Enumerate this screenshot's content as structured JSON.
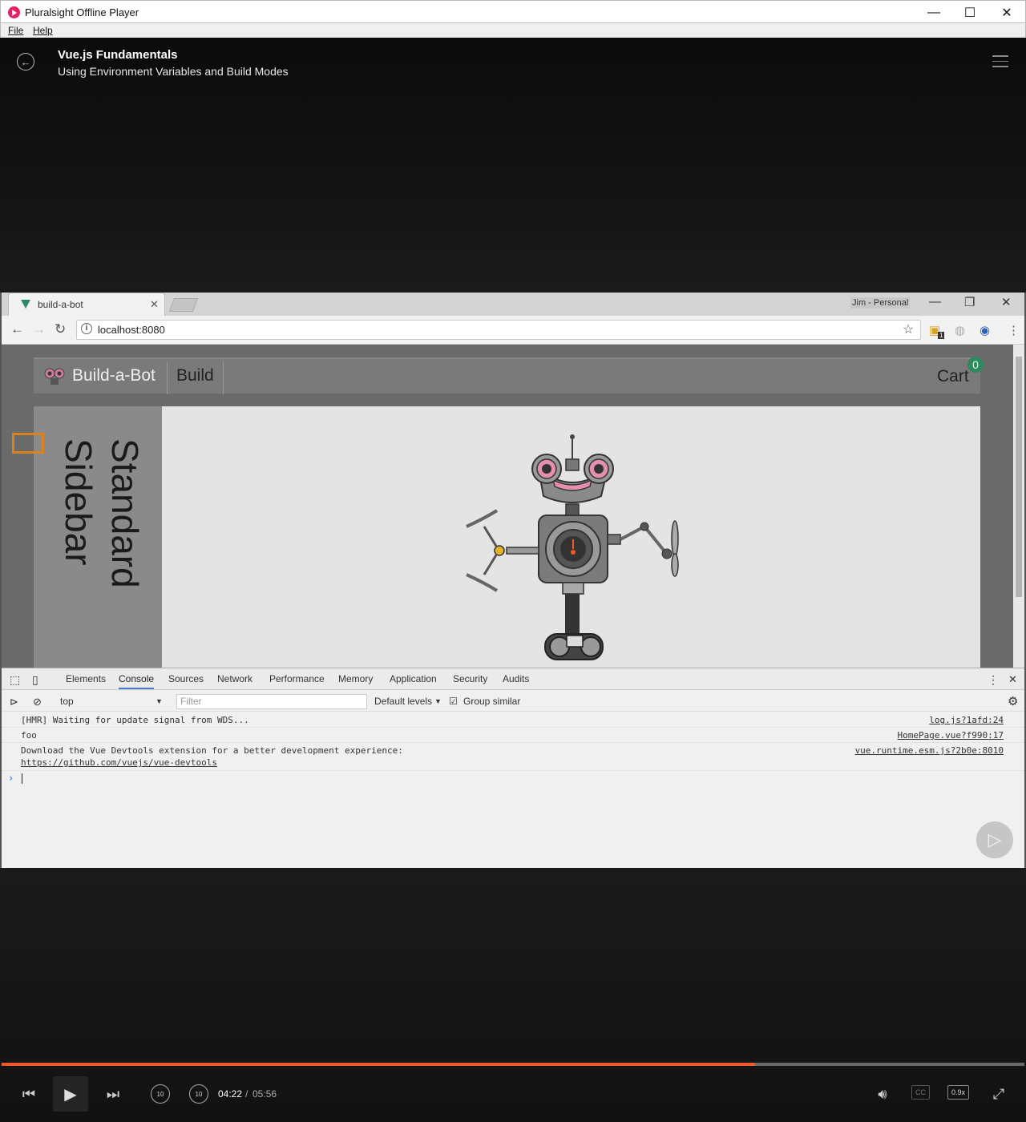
{
  "window": {
    "title": "Pluralsight Offline Player",
    "minimize_glyph": "—",
    "maximize_glyph": "☐",
    "close_glyph": "✕"
  },
  "menu": {
    "file": "File",
    "help": "Help"
  },
  "player": {
    "course_title": "Vue.js Fundamentals",
    "module_title": "Using Environment Variables and Build Modes",
    "current_time": "04:22",
    "separator": "/",
    "total_time": "05:56",
    "progress_fraction": 0.737,
    "speed": "0.9x",
    "cc_label": "CC",
    "skip_back_label": "10",
    "skip_forward_label": "10",
    "accent_color": "#f05a28"
  },
  "browser": {
    "tab_title": "build-a-bot",
    "profile": "Jim - Personal",
    "url": "localhost:8080",
    "extension_badge": "1"
  },
  "site": {
    "brand": "Build-a-Bot",
    "nav_build": "Build",
    "cart_label": "Cart",
    "cart_count": "0",
    "sidebar_text": "Standard Sidebar"
  },
  "devtools": {
    "tabs": [
      "Elements",
      "Console",
      "Sources",
      "Network",
      "Performance",
      "Memory",
      "Application",
      "Security",
      "Audits"
    ],
    "active_tab": "Console",
    "context": "top",
    "filter_placeholder": "Filter",
    "levels": "Default levels",
    "group_similar": "Group similar",
    "console": [
      {
        "message": "[HMR] Waiting for update signal from WDS...",
        "source": "log.js?1afd:24"
      },
      {
        "message": "foo",
        "source": "HomePage.vue?f990:17"
      },
      {
        "message": "Download the Vue Devtools extension for a better development experience:",
        "link": "https://github.com/vuejs/vue-devtools",
        "source": "vue.runtime.esm.js?2b0e:8010"
      }
    ],
    "prompt_glyph": "›"
  }
}
